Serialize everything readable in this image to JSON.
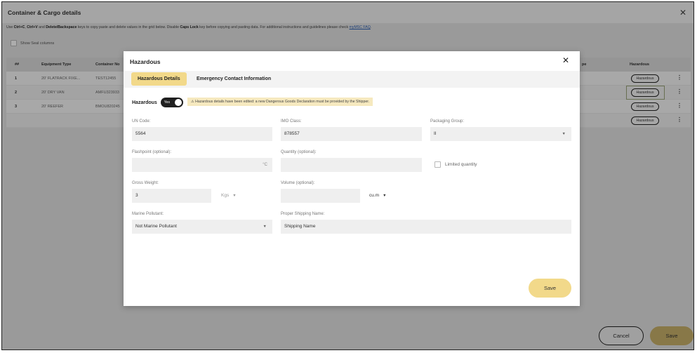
{
  "frame": {
    "title": "Container & Cargo details",
    "close_glyph": "✕",
    "hint": {
      "part1": "Use ",
      "key1": "Ctrl+C",
      "part2": ", ",
      "key2": "Ctrl+V",
      "part3": " and ",
      "key3": "Delete/Backspace",
      "part4": " keys to copy paste and delete values in the grid below. Disable ",
      "key4": "Caps Lock",
      "part5": " key before copying and pasting data. For additional instructions and guidelines please check ",
      "link": "myMSC FAQ",
      "part6": "."
    },
    "show_seal_label": "Show Seal columns"
  },
  "grid": {
    "headers": {
      "num": "##",
      "equipment": "Equipment Type",
      "container": "Container No",
      "type_partial": "pe",
      "hazardous": "Hazardous"
    },
    "rows": [
      {
        "num": "1",
        "equipment": "20' FLATRACK FIXE...",
        "container": "TEST12455",
        "hazardous": "Hazardous"
      },
      {
        "num": "2",
        "equipment": "20' DRY VAN",
        "container": "AMFU323933",
        "hazardous": "Hazardous"
      },
      {
        "num": "3",
        "equipment": "20' REEFER",
        "container": "BMOU820245",
        "hazardous": "Hazardous"
      },
      {
        "num": "",
        "equipment": "",
        "container": "",
        "hazardous": "Hazardous"
      }
    ],
    "kebab_glyph": "⋮"
  },
  "footer": {
    "cancel_label": "Cancel",
    "save_label": "Save"
  },
  "modal": {
    "title": "Hazardous",
    "close_glyph": "✕",
    "tabs": [
      {
        "label": "Hazardous Details",
        "active": true
      },
      {
        "label": "Emergency Contact Information",
        "active": false
      }
    ],
    "hazardous_label": "Hazardous",
    "toggle_text": "Yes",
    "warning_text": "⚠ Hazardous details have been edited: a new Dangerous Goods Declaration must be provided by the Shipper.",
    "fields": {
      "un_code": {
        "label": "UN Code:",
        "value": "5564"
      },
      "imo_class": {
        "label": "IMO Class:",
        "value": "878557"
      },
      "packaging_group": {
        "label": "Packaging Group:",
        "value": "II"
      },
      "flashpoint": {
        "label": "Flashpoint (optional):",
        "value": "",
        "unit": "°C"
      },
      "quantity": {
        "label": "Quantity (optional):",
        "value": ""
      },
      "limited_quantity": {
        "label": "Limited quantity",
        "checked": false
      },
      "gross_weight": {
        "label": "Gross Weight:",
        "value": "3",
        "unit": "Kgs"
      },
      "volume": {
        "label": "Volume (optional):",
        "value": "",
        "unit": "cu.m"
      },
      "marine_pollutant": {
        "label": "Marine Pollutant:",
        "value": "Not Marine Pollutant"
      },
      "proper_shipping_name": {
        "label": "Proper Shipping Name:",
        "value": "Shipping Name"
      }
    },
    "caret_glyph": "▼",
    "save_label": "Save"
  },
  "colors": {
    "accent_yellow": "#f2d98a",
    "save_gold": "#c9b16a",
    "warning_bg": "#f6e9bf",
    "toggle_dark": "#1f1f1f"
  }
}
